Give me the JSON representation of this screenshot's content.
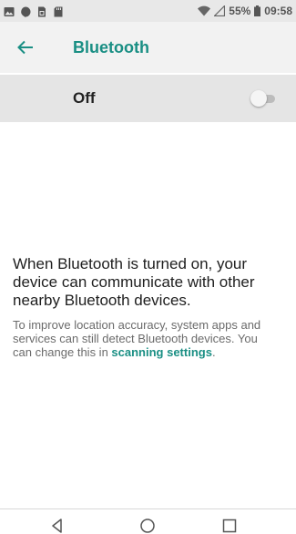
{
  "status_bar": {
    "battery_percent": "55%",
    "time": "09:58",
    "left_icons": [
      "image-icon",
      "hangouts-icon",
      "sim-icon",
      "sd-card-icon"
    ],
    "right_icons": [
      "wifi-icon",
      "signal-icon",
      "battery-icon"
    ]
  },
  "app_bar": {
    "title": "Bluetooth",
    "back_icon": "arrow-left-icon"
  },
  "bluetooth_switch": {
    "label": "Off",
    "state": "off"
  },
  "info": {
    "main_text": "When Bluetooth is turned on, your device can communicate with other nearby Bluetooth devices.",
    "footer_prefix": "To improve location accuracy, system apps and services can still detect Bluetooth devices. You can change this in ",
    "footer_link": "scanning settings",
    "footer_suffix": "."
  },
  "nav_bar": {
    "buttons": [
      "back-triangle-icon",
      "home-circle-icon",
      "recents-square-icon"
    ]
  },
  "colors": {
    "accent": "#1a8f84",
    "app_bar_bg": "#f2f2f2",
    "switch_row_bg": "#e5e5e5",
    "status_bar_bg": "#e8e8e8"
  }
}
